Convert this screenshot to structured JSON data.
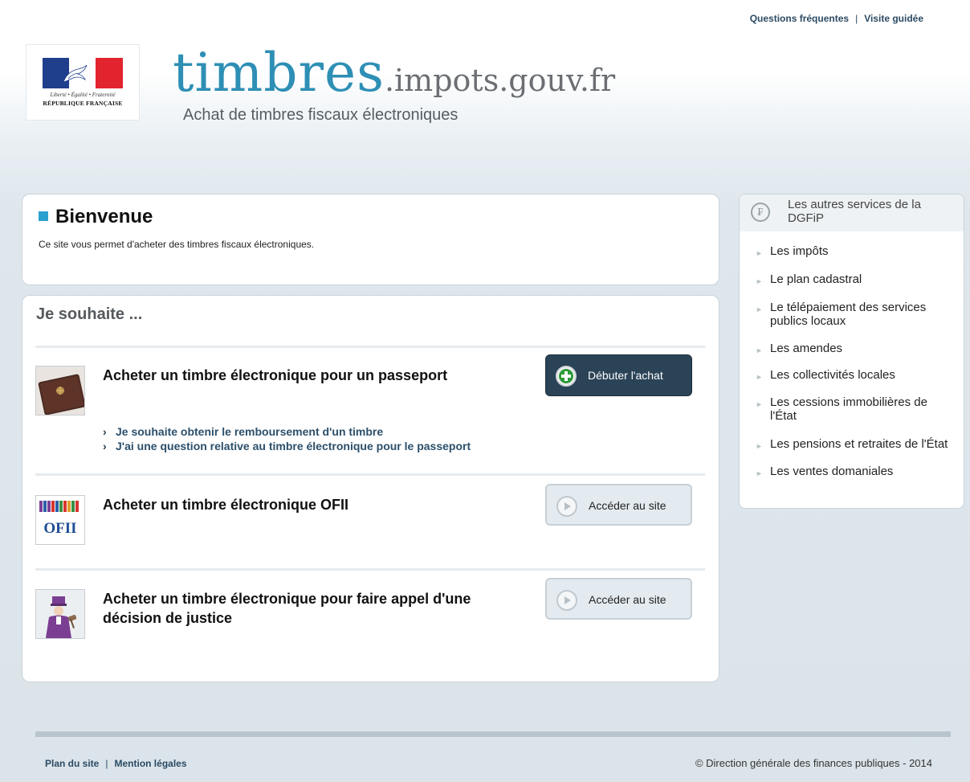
{
  "top_links": {
    "faq": "Questions fréquentes",
    "separator": "|",
    "tour": "Visite guidée"
  },
  "logo": {
    "motto": "Liberté • Égalité • Fraternité",
    "republic": "RÉPUBLIQUE FRANÇAISE"
  },
  "brand": {
    "main": "timbres",
    "domain": ".impots.gouv.fr",
    "tagline": "Achat de timbres fiscaux électroniques"
  },
  "welcome": {
    "title": "Bienvenue",
    "text": "Ce site vous permet d'acheter des timbres fiscaux électroniques."
  },
  "wish": {
    "title": "Je souhaite ...",
    "items": [
      {
        "title": "Acheter un timbre électronique pour un passeport",
        "button": "Débuter l'achat",
        "links": [
          "Je souhaite obtenir le remboursement d'un timbre",
          "J'ai une question relative au timbre électronique pour le passeport"
        ]
      },
      {
        "title": "Acheter un timbre électronique OFII",
        "button": "Accéder au site",
        "thumb_label": "OFII"
      },
      {
        "title": "Acheter un timbre électronique pour faire appel d'une décision de justice",
        "button": "Accéder au site"
      }
    ]
  },
  "sidebar": {
    "title": "Les autres services de la DGFiP",
    "items": [
      "Les impôts",
      "Le plan cadastral",
      "Le télépaiement des services publics locaux",
      "Les amendes",
      "Les collectivités locales",
      "Les cessions immobilières de l'État",
      "Les pensions et retraites de l'État",
      "Les ventes domaniales"
    ]
  },
  "footer": {
    "sitemap": "Plan du site",
    "separator": "|",
    "legal": "Mention légales",
    "copyright": "© Direction générale des finances publiques - 2014"
  },
  "colors": {
    "accent": "#2e8fb5",
    "bullet": "#2ba0cf",
    "dark_button": "#2a4357",
    "link": "#2b4f6b"
  }
}
